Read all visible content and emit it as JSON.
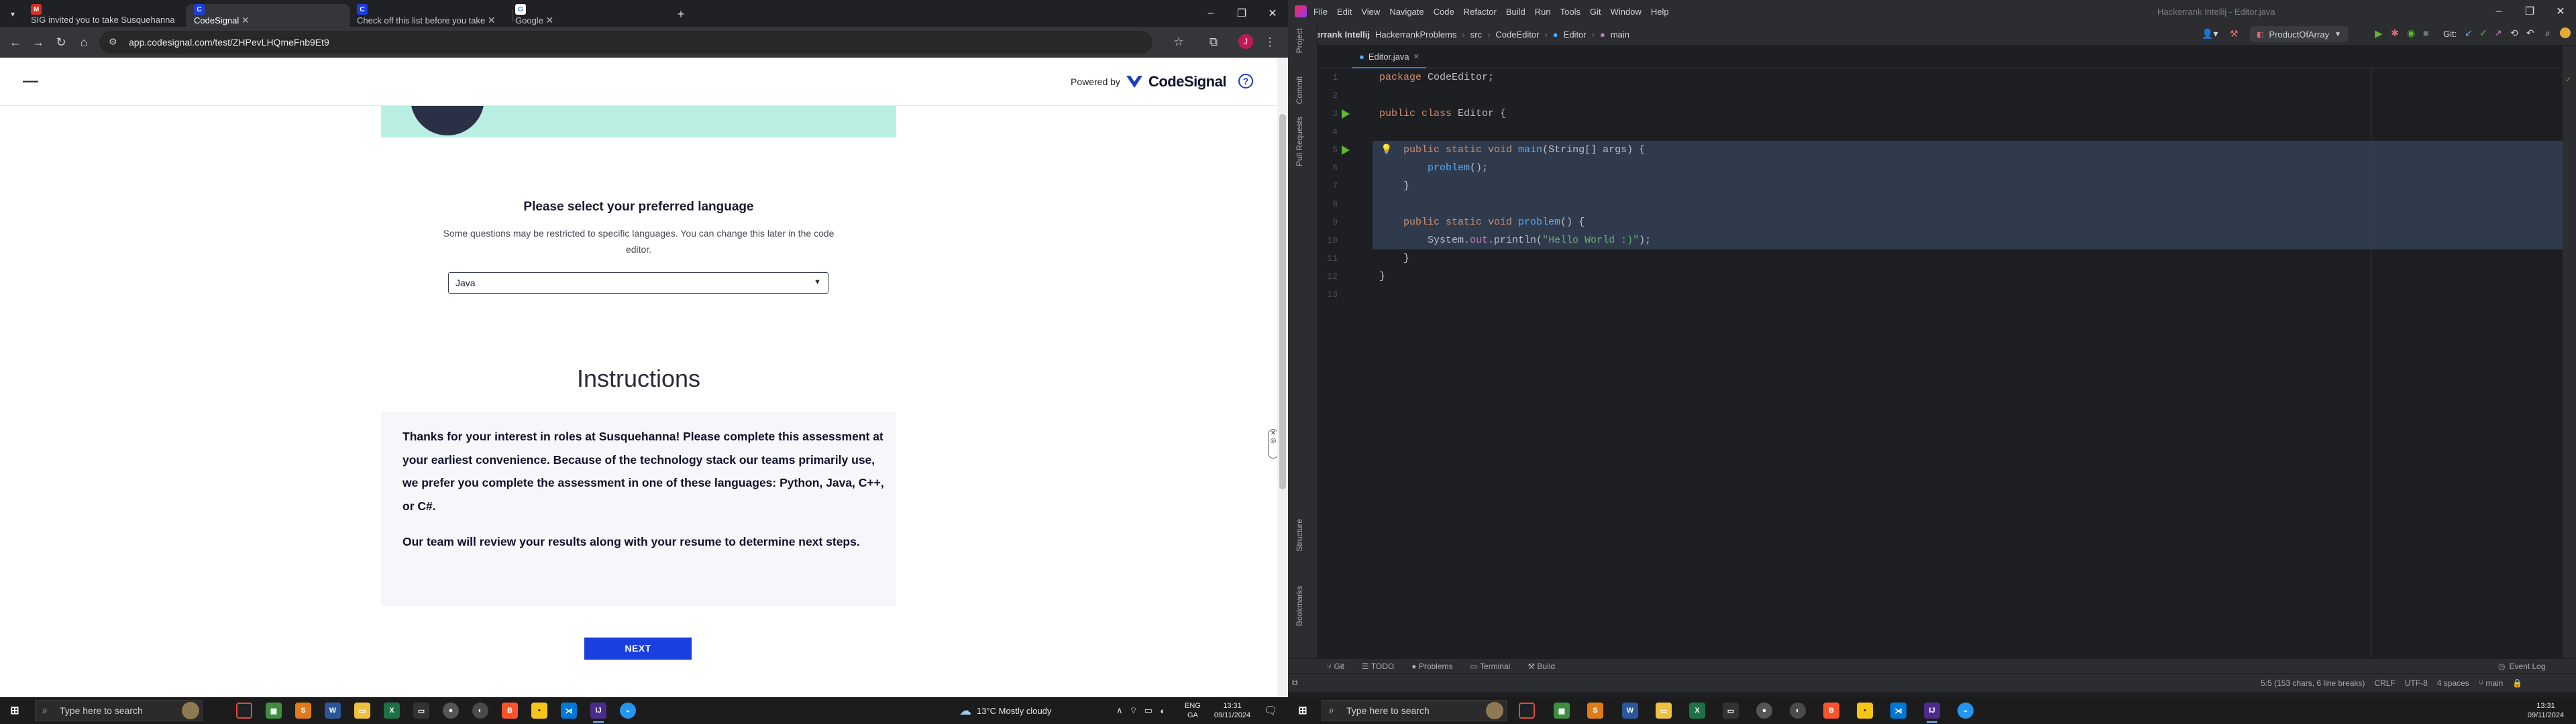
{
  "browser": {
    "tabs": [
      {
        "title": "SIG invited you to take Susquehanna",
        "favicon": "G",
        "color": "#d93025"
      },
      {
        "title": "CodeSignal",
        "favicon": "C",
        "color": "#1a3fe0",
        "active": true
      },
      {
        "title": "Check off this list before you take",
        "favicon": "C",
        "color": "#1a3fe0"
      },
      {
        "title": "Google",
        "favicon": "G",
        "color": "#4285f4"
      }
    ],
    "url": "app.codesignal.com/test/ZHPevLHQmeFnb9Et9",
    "profile_initial": "J"
  },
  "codesignal": {
    "powered_by": "Powered by",
    "brand": "CodeSignal",
    "help": "?",
    "language_title": "Please select your preferred language",
    "language_subtitle": "Some questions may be restricted to specific languages. You can change this later in the code editor.",
    "selected_language": "Java",
    "instructions_title": "Instructions",
    "instructions_p1": "Thanks for your interest in roles at Susquehanna! Please complete this assessment at your earliest convenience. Because of the technology stack our teams primarily use, we prefer you complete the assessment in one of these languages: Python, Java, C++, or C#.",
    "instructions_p2": "Our team will review your results along with your resume to determine next steps.",
    "next_label": "NEXT"
  },
  "taskbar_left": {
    "search_placeholder": "Type here to search",
    "weather": "13°C  Mostly cloudy",
    "lang_top": "ENG",
    "lang_bottom": "GA",
    "time": "13:31",
    "date": "09/11/2024"
  },
  "intellij": {
    "menu": [
      "File",
      "Edit",
      "View",
      "Navigate",
      "Code",
      "Refactor",
      "Build",
      "Run",
      "Tools",
      "Git",
      "Window",
      "Help"
    ],
    "title": "Hackerrank Intellij - Editor.java",
    "breadcrumbs": [
      "Hackerrank Intellij",
      "HackerrankProblems",
      "src",
      "CodeEditor",
      "Editor",
      "main"
    ],
    "run_config": "ProductOfArray",
    "git_label": "Git:",
    "tab": "Editor.java",
    "left_tabs": [
      "Project",
      "Commit",
      "Pull Requests"
    ],
    "left_tabs_bottom": [
      "Structure",
      "Bookmarks"
    ],
    "code": [
      "package CodeEditor;",
      "",
      "public class Editor {",
      "",
      "    public static void main(String[] args) {",
      "        problem();",
      "    }",
      "",
      "    public static void problem() {",
      "        System.out.println(\"Hello World :)\");",
      "    }",
      "}",
      ""
    ],
    "bottom_tabs": [
      "Git",
      "TODO",
      "Problems",
      "Terminal",
      "Build"
    ],
    "event_log": "Event Log",
    "status": {
      "position": "5:5 (153 chars, 6 line breaks)",
      "line_sep": "CRLF",
      "encoding": "UTF-8",
      "indent": "4 spaces",
      "branch": "main"
    }
  },
  "taskbar_right": {
    "search_placeholder": "Type here to search",
    "time": "13:31",
    "date": "09/11/2024"
  }
}
